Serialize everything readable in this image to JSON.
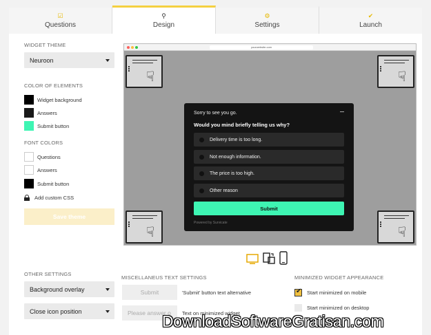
{
  "tabs": [
    {
      "label": "Questions",
      "icon": "checkmark-icon"
    },
    {
      "label": "Design",
      "icon": "search-icon"
    },
    {
      "label": "Settings",
      "icon": "gear-icon"
    },
    {
      "label": "Launch",
      "icon": "check-icon"
    }
  ],
  "sidebar": {
    "widget_theme_heading": "WIDGET THEME",
    "widget_theme_value": "Neuroon",
    "color_heading": "COLOR OF ELEMENTS",
    "color_items": [
      {
        "label": "Widget background",
        "color": "#000000"
      },
      {
        "label": "Answers",
        "color": "#1a1a1a"
      },
      {
        "label": "Submit button",
        "color": "#3ef5b3"
      }
    ],
    "font_heading": "FONT COLORS",
    "font_items": [
      {
        "label": "Questions",
        "color": "#ffffff"
      },
      {
        "label": "Answers",
        "color": "#ffffff"
      },
      {
        "label": "Submit button",
        "color": "#000000"
      }
    ],
    "custom_css_label": "Add custom CSS",
    "save_label": "Save theme"
  },
  "preview": {
    "url": "yourwebsite.com",
    "popup": {
      "intro": "Sorry to see you go.",
      "question": "Would you mind briefly telling us why?",
      "options": [
        "Delivery time is too long.",
        "Not enough information.",
        "The price is too high.",
        "Other reason"
      ],
      "submit": "Submit",
      "powered": "Powered by Survicate"
    }
  },
  "other_settings": {
    "heading": "OTHER SETTINGS",
    "background_overlay": "Background overlay",
    "close_icon_position": "Close icon position"
  },
  "misc": {
    "heading": "MISCELLANEUS TEXT SETTINGS",
    "submit_placeholder": "Submit",
    "submit_label": "'Submit' button text alternative",
    "answer_placeholder": "Please answer o",
    "minimized_label": "Text on minimized widget"
  },
  "minimized": {
    "heading": "MINIMIZED WIDGET APPEARANCE",
    "mobile_label": "Start minimized on mobile",
    "mobile_checked": true,
    "desktop_label": "Start minimized on desktop",
    "desktop_checked": false
  },
  "watermark": "DownloadSoftwareGratisan.com"
}
